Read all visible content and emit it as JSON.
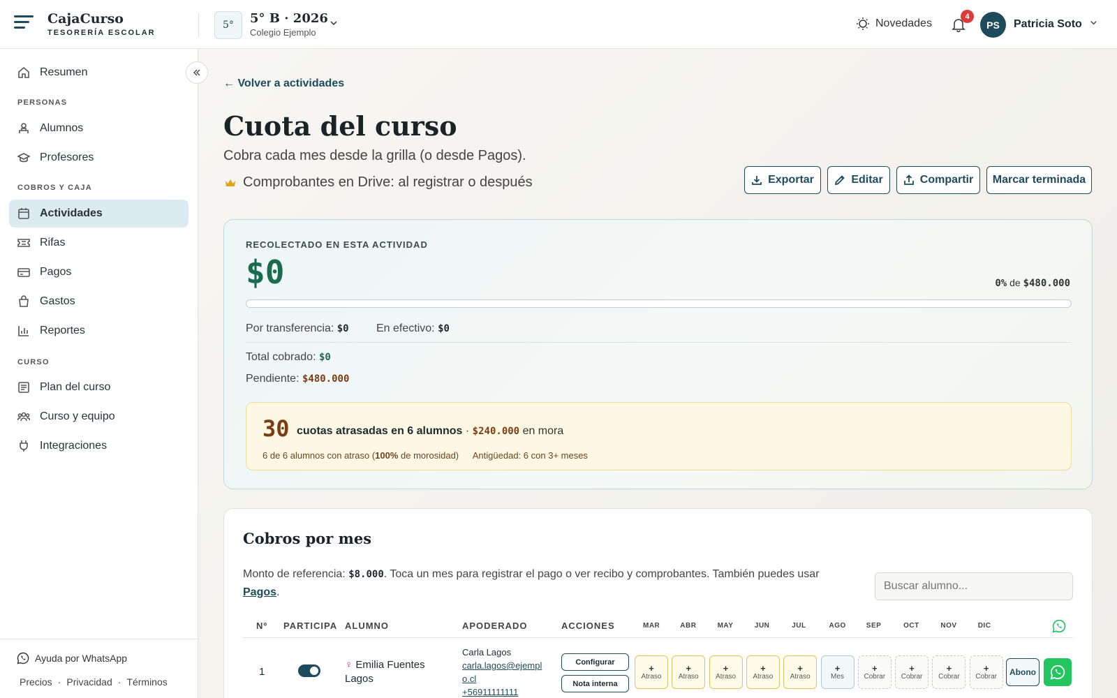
{
  "app": {
    "name": "CajaCurso",
    "subtitle": "TESORERÍA ESCOLAR"
  },
  "course": {
    "badge": "5°",
    "title": "5° B · 2026",
    "school": "Colegio Ejemplo"
  },
  "header": {
    "novedades": "Novedades",
    "notifications_count": "4",
    "user_initials": "PS",
    "user_name": "Patricia Soto"
  },
  "sidebar": {
    "top": {
      "label": "Resumen",
      "icon": "home-icon"
    },
    "sections": [
      {
        "title": "PERSONAS",
        "items": [
          {
            "label": "Alumnos",
            "icon": "student-icon"
          },
          {
            "label": "Profesores",
            "icon": "graduation-icon"
          }
        ]
      },
      {
        "title": "COBROS Y CAJA",
        "items": [
          {
            "label": "Actividades",
            "icon": "calendar-icon",
            "active": true
          },
          {
            "label": "Rifas",
            "icon": "ticket-icon"
          },
          {
            "label": "Pagos",
            "icon": "card-icon"
          },
          {
            "label": "Gastos",
            "icon": "bag-icon"
          },
          {
            "label": "Reportes",
            "icon": "chart-icon"
          }
        ]
      },
      {
        "title": "CURSO",
        "items": [
          {
            "label": "Plan del curso",
            "icon": "list-icon"
          },
          {
            "label": "Curso y equipo",
            "icon": "team-icon"
          },
          {
            "label": "Integraciones",
            "icon": "plug-icon"
          }
        ]
      }
    ],
    "footer": {
      "help": "Ayuda por WhatsApp",
      "links": [
        "Precios",
        "Privacidad",
        "Términos"
      ]
    }
  },
  "page": {
    "back": "← Volver a actividades",
    "title": "Cuota del curso",
    "subtitle": "Cobra cada mes desde la grilla (o desde Pagos).",
    "drive_note": "Comprobantes en Drive: al registrar o después",
    "actions": {
      "export": "Exportar",
      "edit": "Editar",
      "share": "Compartir",
      "finish": "Marcar terminada"
    }
  },
  "summary": {
    "label": "RECOLECTADO EN ESTA ACTIVIDAD",
    "amount": "$0",
    "percent": "0%",
    "goal_sep": "de",
    "goal": "$480.000",
    "progress": 0,
    "transfer_label": "Por transferencia:",
    "transfer_value": "$0",
    "cash_label": "En efectivo:",
    "cash_value": "$0",
    "total_label": "Total cobrado:",
    "total_value": "$0",
    "pending_label": "Pendiente:",
    "pending_value": "$480.000",
    "warning": {
      "count": "30",
      "text": "cuotas atrasadas en 6 alumnos",
      "sep": "·",
      "amount": "$240.000",
      "amount_suffix": "en mora",
      "detail_1a": "6 de 6 alumnos con atraso (",
      "detail_1b": "100%",
      "detail_1c": "de morosidad)",
      "detail_2a": "Antigüedad:",
      "detail_2b": "6 con 3+ meses"
    }
  },
  "cobros": {
    "title": "Cobros por mes",
    "desc_a": "Monto de referencia:",
    "ref_amount": "$8.000",
    "desc_b": ". Toca un mes para registrar el pago o ver recibo y comprobantes. También puedes usar",
    "desc_link": "Pagos",
    "desc_c": ".",
    "search_placeholder": "Buscar alumno...",
    "columns": {
      "n": "Nº",
      "participa": "PARTICIPA",
      "alumno": "ALUMNO",
      "apoderado": "APODERADO",
      "acciones": "ACCIONES"
    },
    "months": [
      "MAR",
      "ABR",
      "MAY",
      "JUN",
      "JUL",
      "AGO",
      "SEP",
      "OCT",
      "NOV",
      "DIC"
    ],
    "rows": [
      {
        "n": "1",
        "student_symbol": "♀",
        "student": "Emilia Fuentes Lagos",
        "guardian": "Carla Lagos",
        "email": "carla.lagos@ejemplo.cl",
        "phone": "+56911111111",
        "btn_config": "Configurar",
        "btn_note": "Nota interna",
        "cells": [
          {
            "status": "atraso",
            "label": "Atraso"
          },
          {
            "status": "atraso",
            "label": "Atraso"
          },
          {
            "status": "atraso",
            "label": "Atraso"
          },
          {
            "status": "atraso",
            "label": "Atraso"
          },
          {
            "status": "atraso",
            "label": "Atraso"
          },
          {
            "status": "mes",
            "label": "Mes"
          },
          {
            "status": "cobrar",
            "label": "Cobrar"
          },
          {
            "status": "cobrar",
            "label": "Cobrar"
          },
          {
            "status": "cobrar",
            "label": "Cobrar"
          },
          {
            "status": "cobrar",
            "label": "Cobrar"
          }
        ],
        "abono": "Abono"
      }
    ]
  },
  "colors": {
    "primary": "#1e4b5c",
    "money": "#1b6b4f",
    "warning_bg": "#fdf7e3",
    "whatsapp": "#22c55e"
  }
}
